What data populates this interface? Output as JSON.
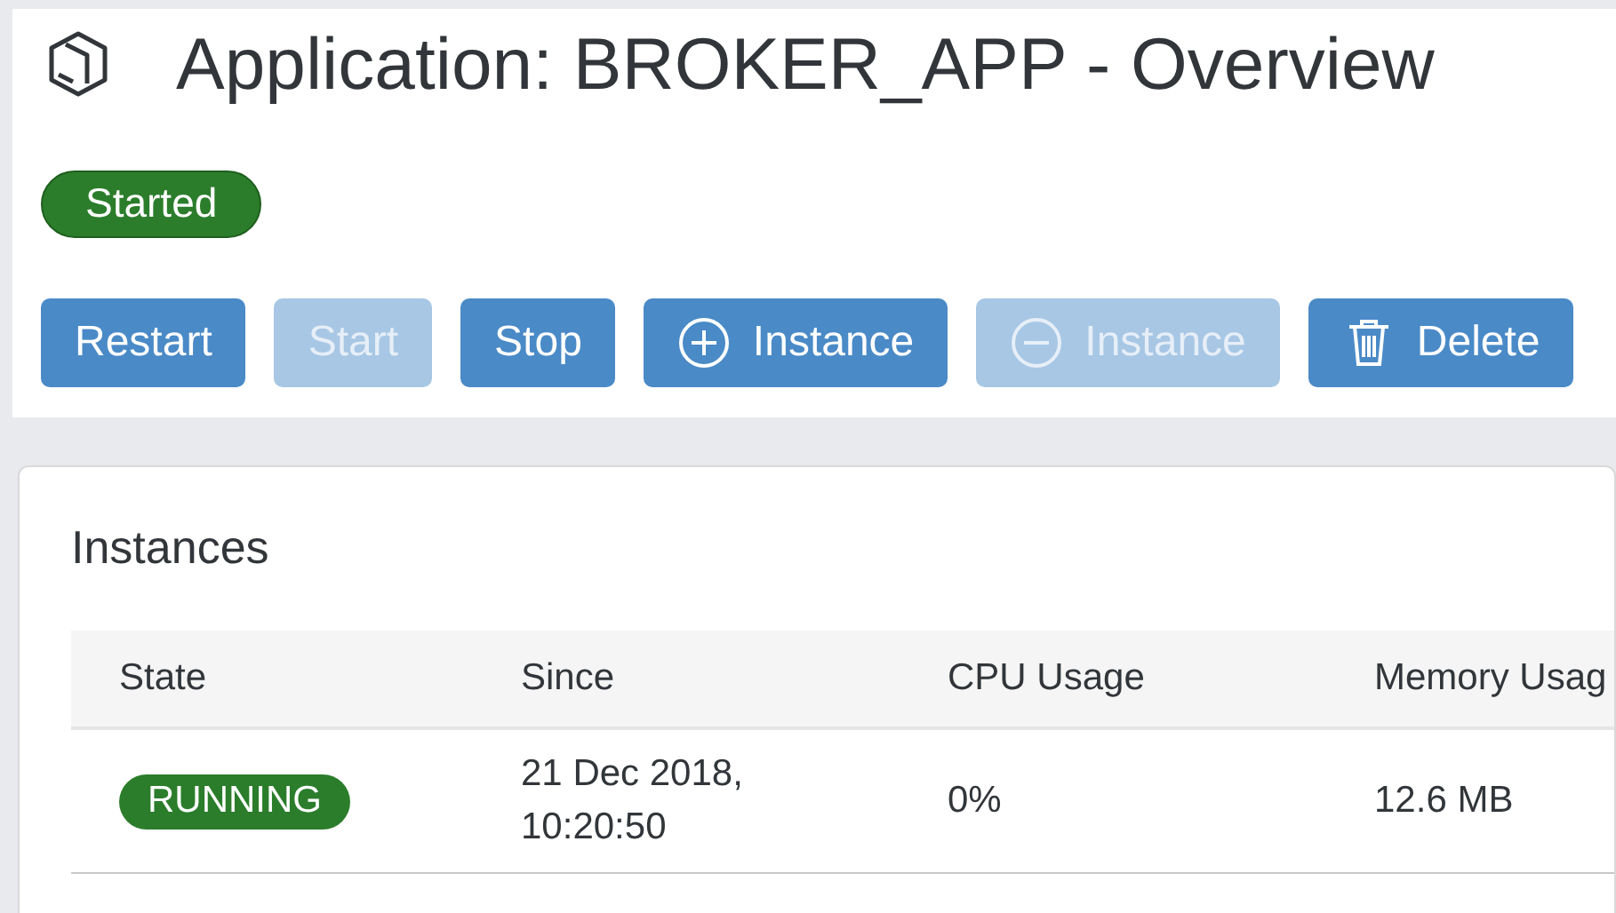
{
  "header": {
    "title": "Application: BROKER_APP - Overview",
    "status": "Started"
  },
  "actions": [
    {
      "label": "Restart",
      "kind": "text",
      "disabled": false
    },
    {
      "label": "Start",
      "kind": "text",
      "disabled": true
    },
    {
      "label": "Stop",
      "kind": "text",
      "disabled": false
    },
    {
      "label": "Instance",
      "kind": "add",
      "disabled": false
    },
    {
      "label": "Instance",
      "kind": "remove",
      "disabled": true
    },
    {
      "label": "Delete",
      "kind": "delete",
      "disabled": false
    }
  ],
  "instances": {
    "title": "Instances",
    "columns": [
      "State",
      "Since",
      "CPU Usage",
      "Memory Usag"
    ],
    "rows": [
      {
        "state": "RUNNING",
        "since": [
          "21 Dec 2018,",
          "10:20:50"
        ],
        "cpu": "0%",
        "memory": "12.6 MB"
      }
    ]
  }
}
